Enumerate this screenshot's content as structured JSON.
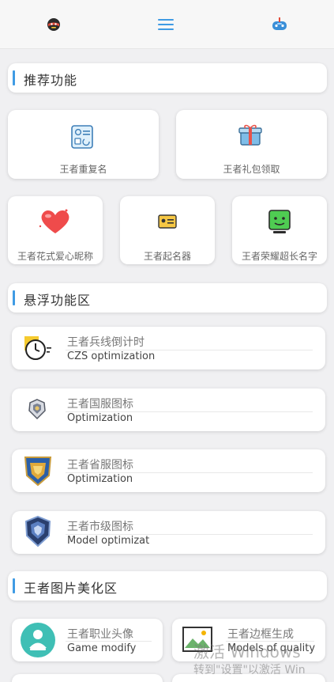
{
  "topnav": {
    "left_icon": "smiley-face-icon",
    "center_icon": "menu-icon",
    "right_icon": "game-controller-icon"
  },
  "sections": [
    {
      "title": "推荐功能"
    },
    {
      "title": "悬浮功能区"
    },
    {
      "title": "王者图片美化区"
    }
  ],
  "recommended": {
    "row1": [
      {
        "label": "王者重复名",
        "icon": "id-card-icon"
      },
      {
        "label": "王者礼包领取",
        "icon": "gift-icon"
      }
    ],
    "row2": [
      {
        "label": "王者花式爱心昵称",
        "icon": "heart-icon"
      },
      {
        "label": "王者起名器",
        "icon": "name-card-icon"
      },
      {
        "label": "王者荣耀超长名字",
        "icon": "robot-screen-icon"
      }
    ]
  },
  "floating": [
    {
      "title": "王者兵线倒计时",
      "subtitle": "CZS optimization",
      "icon": "stopwatch-icon"
    },
    {
      "title": "王者国服图标",
      "subtitle": "Optimization",
      "icon": "national-badge-icon"
    },
    {
      "title": "王者省服图标",
      "subtitle": "Optimization",
      "icon": "province-badge-icon"
    },
    {
      "title": "王者市级图标",
      "subtitle": "Model optimizat",
      "icon": "city-badge-icon"
    }
  ],
  "beautify": [
    {
      "title": "王者职业头像",
      "subtitle": "Game modify",
      "icon": "avatar-icon"
    },
    {
      "title": "王者边框生成",
      "subtitle": "Models of quality",
      "icon": "picture-frame-icon"
    }
  ],
  "watermark": {
    "line1": "激活 Windows",
    "line2": "转到\"设置\"以激活 Win"
  },
  "colors": {
    "accent": "#3f9be4",
    "background": "#f0f0f2"
  }
}
